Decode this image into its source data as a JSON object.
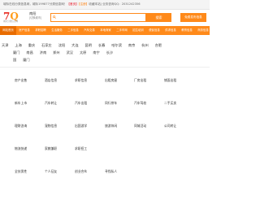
{
  "topbar": {
    "text_a": "城际在线分类信息网，城际199877分类信息网！",
    "text_hl": "【首页】",
    "text_b": "【注册】",
    "text_c": "收藏本站",
    "text_d": "| 业务咨询QQ：2031242356"
  },
  "logo": {
    "mark_main": "7",
    "mark_q": "Q",
    "sub": "城际分类信息网"
  },
  "site": {
    "name": "南阳",
    "switch_city": "[切换城市]"
  },
  "search": {
    "placeholder": "",
    "button_label": "搜索"
  },
  "post_button_label": "免费发布信息",
  "nav": {
    "items": [
      "网站首页",
      "房产信息",
      "求职招聘",
      "生活服务",
      "二手信息",
      "汽车交易",
      "本地商家",
      "二手车网",
      "招生培训",
      "便民信息",
      "供求信息",
      "教育信息",
      "商务信息"
    ]
  },
  "cities": {
    "row1": [
      "天津",
      "上海",
      "重庆",
      "石家庄",
      "沈阳",
      "大连",
      "昆明",
      "长春",
      "哈尔滨",
      "南京",
      "杭州",
      "合肥"
    ],
    "row2": [
      "厦门",
      "南昌",
      "济南",
      "郑州",
      "武汉",
      "太原",
      "南宁",
      "长沙"
    ],
    "row3": [
      "国",
      "厦门"
    ]
  },
  "categories": {
    "rows": [
      [
        "房产出售",
        "酒店信息",
        "求职信息",
        "出租房屋",
        "厂房出租",
        "铺面出租"
      ],
      [
        "新车上市",
        "汽车转让",
        "汽车出租",
        "同行拼车",
        "汽车驾校",
        "二手买卖"
      ],
      [
        "理财咨询",
        "宠物信息",
        "出国游学",
        "旅游休闲",
        "同城活动",
        "公司转让"
      ],
      [
        "物流快递",
        "家教兼职",
        "求职招工",
        "",
        "",
        ""
      ],
      [
        "全技男性",
        "个人征友",
        "创业合伙",
        "寻找私人",
        "",
        ""
      ]
    ]
  }
}
